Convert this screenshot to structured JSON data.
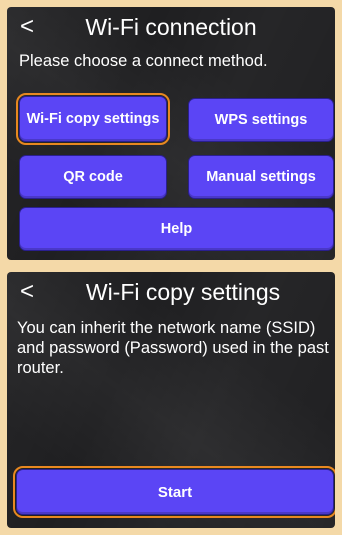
{
  "top_panel": {
    "back_glyph": "<",
    "title": "Wi-Fi connection",
    "prompt": "Please choose a connect method.",
    "buttons": {
      "wifi_copy": "Wi-Fi copy settings",
      "wps": "WPS settings",
      "qr_code": "QR code",
      "manual": "Manual settings",
      "help": "Help"
    },
    "selected": "wifi_copy"
  },
  "bottom_panel": {
    "back_glyph": "<",
    "title": "Wi-Fi copy settings",
    "description": "You can inherit the network name (SSID) and password (Password) used in the past router.",
    "start_label": "Start",
    "selected": "start"
  },
  "colors": {
    "page_background": "#f4d9a8",
    "panel_background": "#1f1f21",
    "button": "#5b45f5",
    "selection_outline": "#e88820",
    "text": "#ffffff"
  }
}
